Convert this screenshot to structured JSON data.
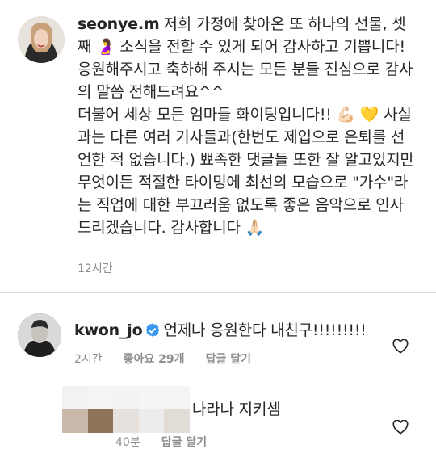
{
  "post": {
    "username": "seonye.m",
    "caption": "저희 가정에 찾아온 또 하나의 선물, 셋째 🤰 소식을 전할 수 있게 되어 감사하고 기쁩니다! 응원해주시고 축하해 주시는 모든 분들 진심으로 감사의 말씀 전해드려요^^\n더불어 세상 모든 엄마들 화이팅입니다!! 💪🏻 💛 사실과는 다른 여러 기사들과(한번도 제입으로 은퇴를 선언한 적 없습니다.) 뾰족한 댓글들 또한 잘 알고있지만 무엇이든 적절한 타이밍에 최선의 모습으로 \"가수\"라는 직업에 대한 부끄러움 없도록 좋은 음악으로 인사드리겠습니다. 감사합니다 🙏🏻",
    "time": "12시간"
  },
  "comments": [
    {
      "username": "kwon_jo",
      "verified": true,
      "text": "언제나 응원한다 내친구!!!!!!!!!",
      "time": "2시간",
      "likes": "좋아요 29개",
      "reply_label": "답글 달기"
    },
    {
      "username_hidden": true,
      "text": "나라나 지키셈",
      "time": "40분",
      "reply_label": "답글 달기"
    }
  ],
  "colors": {
    "text": "#262626",
    "meta": "#8e8e8e",
    "verified": "#3897f0",
    "divider": "#dbdbdb"
  },
  "icons": {
    "verified": "verified-badge-icon",
    "like": "heart-outline-icon"
  }
}
